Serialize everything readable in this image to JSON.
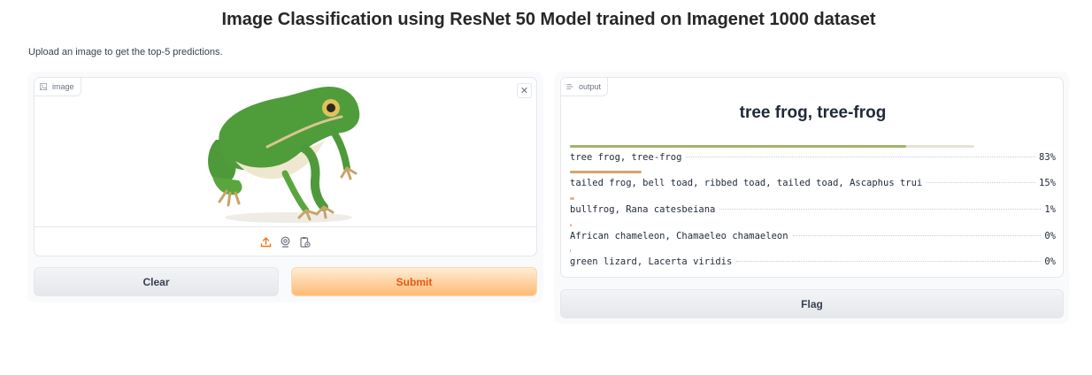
{
  "header": {
    "title": "Image Classification using ResNet 50 Model trained on Imagenet 1000 dataset",
    "description": "Upload an image to get the top-5 predictions."
  },
  "input": {
    "label": "image",
    "icon": "image-icon",
    "close_symbol": "✕",
    "image_subject": "green tree frog",
    "toolbar_icons": [
      "upload-icon",
      "webcam-icon",
      "clipboard-icon"
    ]
  },
  "buttons": {
    "clear": "Clear",
    "submit": "Submit",
    "flag": "Flag"
  },
  "output": {
    "label": "output",
    "icon": "label-icon",
    "top_prediction": "tree frog, tree-frog",
    "predictions": [
      {
        "name": "tree frog, tree-frog",
        "percent": "83%",
        "confidence": 0.83
      },
      {
        "name": "tailed frog, bell toad, ribbed toad, tailed toad, Ascaphus trui",
        "percent": "15%",
        "confidence": 0.15
      },
      {
        "name": "bullfrog, Rana catesbeiana",
        "percent": "1%",
        "confidence": 0.01
      },
      {
        "name": "African chameleon, Chamaeleo chamaeleon",
        "percent": "0%",
        "confidence": 0.002
      },
      {
        "name": "green lizard, Lacerta viridis",
        "percent": "0%",
        "confidence": 0.001
      }
    ]
  },
  "colors": {
    "accent_orange": "#f97316",
    "bar_green": "#a3b56a",
    "bar_orange": "#d4a46c"
  }
}
